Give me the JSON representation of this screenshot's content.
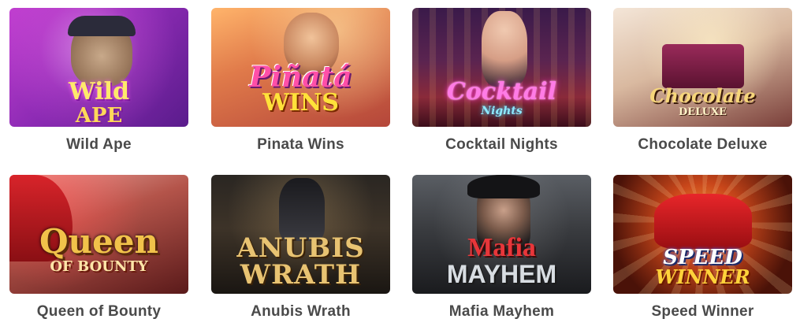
{
  "games": [
    {
      "title": "Wild Ape",
      "logo_line1": "Wild",
      "logo_line2": "APE"
    },
    {
      "title": "Pinata Wins",
      "logo_line1": "Piñatá",
      "logo_line2": "WINS"
    },
    {
      "title": "Cocktail Nights",
      "logo_line1": "Cocktail",
      "logo_line2": "Nights"
    },
    {
      "title": "Chocolate Deluxe",
      "logo_line1": "Chocolate",
      "logo_line2": "DELUXE"
    },
    {
      "title": "Queen of Bounty",
      "logo_line1": "Queen",
      "logo_line2": "OF BOUNTY"
    },
    {
      "title": "Anubis Wrath",
      "logo_line1": "ANUBIS",
      "logo_line2": "WRATH"
    },
    {
      "title": "Mafia Mayhem",
      "logo_line1": "Mafia",
      "logo_line2": "MAYHEM"
    },
    {
      "title": "Speed Winner",
      "logo_line1": "SPEED",
      "logo_line2": "WINNER"
    }
  ],
  "colors": {
    "title_text": "#4a4a4a",
    "background": "#ffffff"
  }
}
